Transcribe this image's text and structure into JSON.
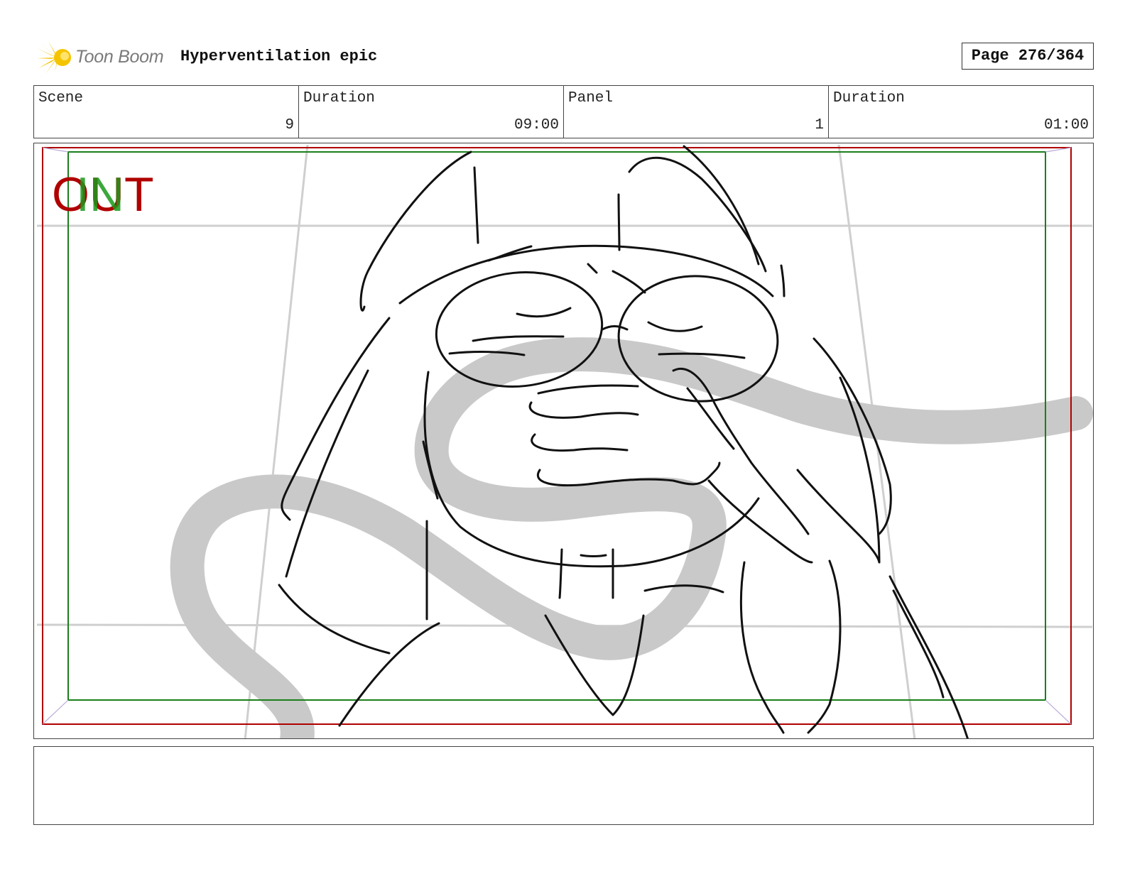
{
  "header": {
    "logo_text": "Toon Boom",
    "project_title": "Hyperventilation epic",
    "page_label": "Page 276/364"
  },
  "info": {
    "scene_label": "Scene",
    "scene_value": "9",
    "scene_duration_label": "Duration",
    "scene_duration_value": "09:00",
    "panel_label": "Panel",
    "panel_value": "1",
    "panel_duration_label": "Duration",
    "panel_duration_value": "01:00"
  },
  "panel": {
    "out_label": "OUT",
    "in_label": "IN",
    "colors": {
      "out_frame": "#b00000",
      "in_frame": "#1a7f1a",
      "guide": "#c8c8c8",
      "sketch": "#111111"
    }
  },
  "notes": {
    "text": ""
  }
}
